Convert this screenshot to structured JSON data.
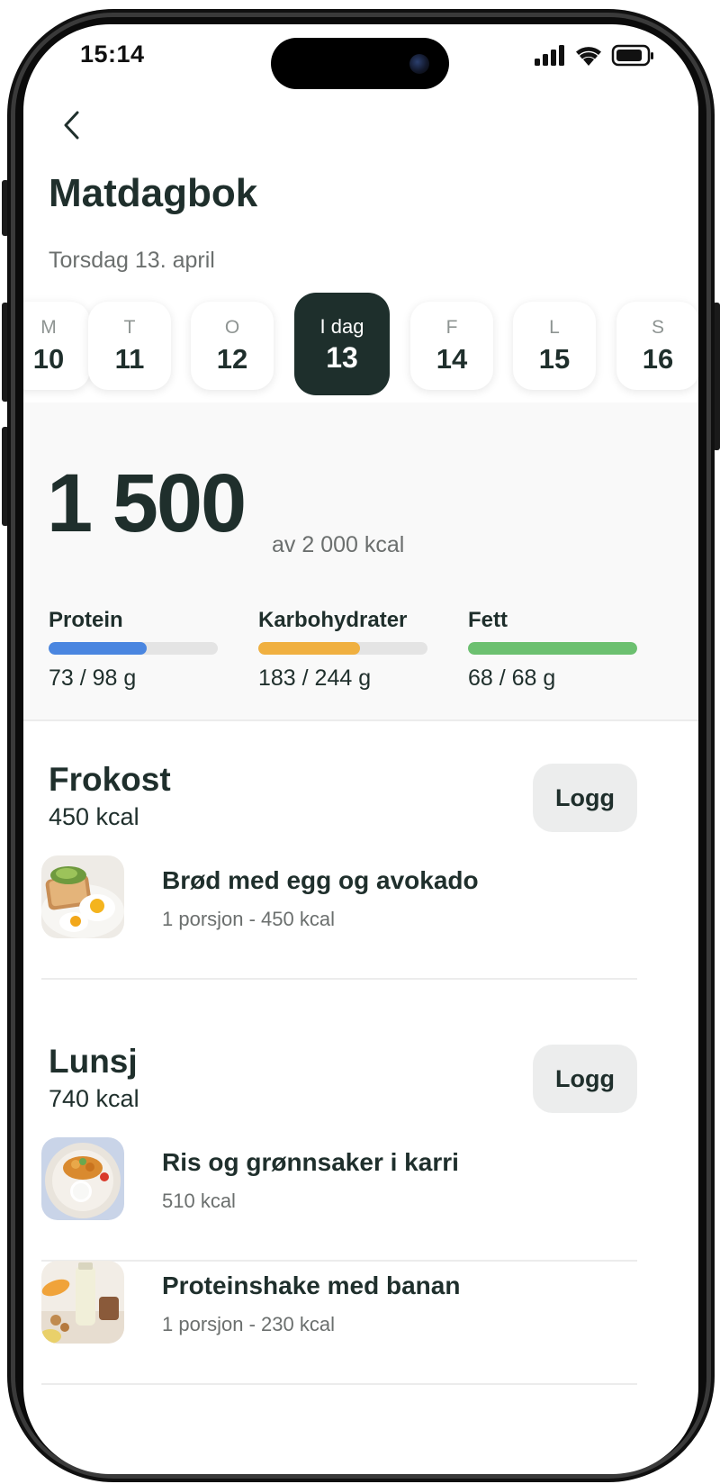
{
  "status_bar": {
    "time": "15:14"
  },
  "header": {
    "title": "Matdagbok",
    "date": "Torsdag 13. april"
  },
  "days": [
    {
      "letter": "M",
      "number": "10"
    },
    {
      "letter": "T",
      "number": "11"
    },
    {
      "letter": "O",
      "number": "12"
    },
    {
      "letter": "I dag",
      "number": "13",
      "active": true
    },
    {
      "letter": "F",
      "number": "14"
    },
    {
      "letter": "L",
      "number": "15"
    },
    {
      "letter": "S",
      "number": "16"
    }
  ],
  "summary": {
    "calories": "1 500",
    "goal": "av 2 000 kcal",
    "macros": [
      {
        "name": "Protein",
        "value": "73 / 98 g",
        "progress": 0.58,
        "color": "#4a86e0"
      },
      {
        "name": "Karbohydrater",
        "value": "183 / 244 g",
        "progress": 0.6,
        "color": "#f0b040"
      },
      {
        "name": "Fett",
        "value": "68 / 68 g",
        "progress": 1.0,
        "color": "#6cc070"
      }
    ]
  },
  "meals": [
    {
      "title": "Frokost",
      "kcal": "450 kcal",
      "log_label": "Logg",
      "items": [
        {
          "name": "Brød med egg og avokado",
          "detail": "1 porsjon - 450 kcal",
          "icon": "toast-egg-avocado-photo"
        }
      ]
    },
    {
      "title": "Lunsj",
      "kcal": "740 kcal",
      "log_label": "Logg",
      "items": [
        {
          "name": "Ris og grønnsaker i karri",
          "detail": "510 kcal",
          "icon": "rice-curry-photo"
        },
        {
          "name": "Proteinshake med banan",
          "detail": "1 porsjon - 230 kcal",
          "icon": "protein-shake-photo"
        }
      ]
    }
  ]
}
